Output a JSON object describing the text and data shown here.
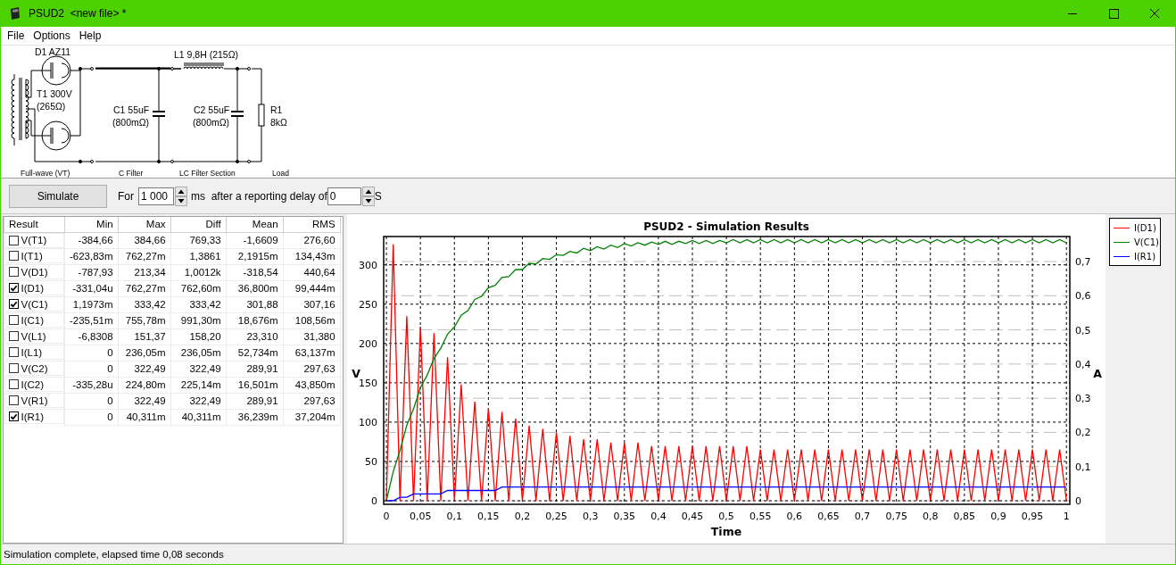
{
  "window": {
    "title": "PSUD2  <new file> *"
  },
  "menu": [
    {
      "label": "File"
    },
    {
      "label": "Options"
    },
    {
      "label": "Help"
    }
  ],
  "schematic": {
    "rectifier": {
      "name": "D1 AZ11",
      "transformer": "T1 300V",
      "resistance": "(265Ω)"
    },
    "inductor": "L1 9,8H (215Ω)",
    "capacitors": [
      {
        "value": "C1 55uF",
        "esr": "(800mΩ)"
      },
      {
        "value": "C2 55uF",
        "esr": "(800mΩ)"
      }
    ],
    "load": {
      "name": "R1",
      "value": "8kΩ"
    },
    "sections": [
      "Full-wave (VT)",
      "C Filter",
      "LC Filter Section",
      "Load"
    ]
  },
  "controls": {
    "simulate": "Simulate",
    "for_label": "For",
    "duration": "1 000",
    "ms_label": "ms  after a reporting delay of",
    "delay": "0",
    "s_label": "S"
  },
  "results": {
    "columns": [
      "Result",
      "Min",
      "Max",
      "Diff",
      "Mean",
      "RMS"
    ],
    "rows": [
      {
        "name": "V(T1)",
        "checked": false,
        "values": [
          "-384,66",
          "384,66",
          "769,33",
          "-1,6609",
          "276,60"
        ]
      },
      {
        "name": "I(T1)",
        "checked": false,
        "values": [
          "-623,83m",
          "762,27m",
          "1,3861",
          "2,1915m",
          "134,43m"
        ]
      },
      {
        "name": "V(D1)",
        "checked": false,
        "values": [
          "-787,93",
          "213,34",
          "1,0012k",
          "-318,54",
          "440,64"
        ]
      },
      {
        "name": "I(D1)",
        "checked": true,
        "values": [
          "-331,04u",
          "762,27m",
          "762,60m",
          "36,800m",
          "99,444m"
        ]
      },
      {
        "name": "V(C1)",
        "checked": true,
        "values": [
          "1,1973m",
          "333,42",
          "333,42",
          "301,88",
          "307,16"
        ]
      },
      {
        "name": "I(C1)",
        "checked": false,
        "values": [
          "-235,51m",
          "755,78m",
          "991,30m",
          "18,676m",
          "108,56m"
        ]
      },
      {
        "name": "V(L1)",
        "checked": false,
        "values": [
          "-6,8308",
          "151,37",
          "158,20",
          "23,310",
          "31,380"
        ]
      },
      {
        "name": "I(L1)",
        "checked": false,
        "values": [
          "0",
          "236,05m",
          "236,05m",
          "52,734m",
          "63,137m"
        ]
      },
      {
        "name": "V(C2)",
        "checked": false,
        "values": [
          "0",
          "322,49",
          "322,49",
          "289,91",
          "297,63"
        ]
      },
      {
        "name": "I(C2)",
        "checked": false,
        "values": [
          "-335,28u",
          "224,80m",
          "225,14m",
          "16,501m",
          "43,850m"
        ]
      },
      {
        "name": "V(R1)",
        "checked": false,
        "values": [
          "0",
          "322,49",
          "322,49",
          "289,91",
          "297,63"
        ]
      },
      {
        "name": "I(R1)",
        "checked": true,
        "values": [
          "0",
          "40,311m",
          "40,311m",
          "36,239m",
          "37,204m"
        ]
      }
    ]
  },
  "chart": {
    "chart_data": {
      "type": "line",
      "title": "PSUD2 - Simulation Results",
      "xlabel": "Time",
      "ylabel": "V",
      "y2label": "A",
      "grid": true,
      "xlim": [
        -0.004,
        1.005
      ],
      "ylim": [
        -4.5,
        336
      ],
      "y2lim": [
        -0.0104,
        0.7731
      ],
      "xticks": [
        0,
        {
          "value": 0.05,
          "label": "0,05"
        },
        {
          "value": 0.1,
          "label": "0,1"
        },
        {
          "value": 0.15,
          "label": "0,15"
        },
        {
          "value": 0.2,
          "label": "0,2"
        },
        {
          "value": 0.25,
          "label": "0,25"
        },
        {
          "value": 0.3,
          "label": "0,3"
        },
        {
          "value": 0.35,
          "label": "0,35"
        },
        {
          "value": 0.4,
          "label": "0,4"
        },
        {
          "value": 0.45,
          "label": "0,45"
        },
        {
          "value": 0.5,
          "label": "0,5"
        },
        {
          "value": 0.55,
          "label": "0,55"
        },
        {
          "value": 0.6,
          "label": "0,6"
        },
        {
          "value": 0.65,
          "label": "0,65"
        },
        {
          "value": 0.7,
          "label": "0,7"
        },
        {
          "value": 0.75,
          "label": "0,75"
        },
        {
          "value": 0.8,
          "label": "0,8"
        },
        {
          "value": 0.85,
          "label": "0,85"
        },
        {
          "value": 0.9,
          "label": "0,9"
        },
        {
          "value": 0.95,
          "label": "0,95"
        },
        1
      ],
      "yticks": [
        0,
        50,
        100,
        150,
        200,
        250,
        300
      ],
      "y2ticks": [
        0,
        {
          "value": 0.1,
          "label": "0,1"
        },
        {
          "value": 0.2,
          "label": "0,2"
        },
        {
          "value": 0.3,
          "label": "0,3"
        },
        {
          "value": 0.4,
          "label": "0,4"
        },
        {
          "value": 0.5,
          "label": "0,5"
        },
        {
          "value": 0.6,
          "label": "0,6"
        },
        {
          "value": 0.7,
          "label": "0,7"
        }
      ],
      "x": [
        0,
        0.01,
        0.02,
        0.03,
        0.04,
        0.05,
        0.06,
        0.07,
        0.08,
        0.09,
        0.1,
        0.11,
        0.12,
        0.13,
        0.14,
        0.15,
        0.16,
        0.17,
        0.18,
        0.19,
        0.2,
        0.21,
        0.22,
        0.23,
        0.24,
        0.25,
        0.26,
        0.27,
        0.28,
        0.29,
        0.3,
        0.31,
        0.32,
        0.33,
        0.34,
        0.35,
        0.36,
        0.37,
        0.38,
        0.39,
        0.4,
        0.41,
        0.42,
        0.43,
        0.44,
        0.45,
        0.46,
        0.47,
        0.48,
        0.49,
        0.5,
        0.51,
        0.52,
        0.53,
        0.54,
        0.55,
        0.56,
        0.57,
        0.58,
        0.59,
        0.6,
        0.61,
        0.62,
        0.63,
        0.64,
        0.65,
        0.66,
        0.67,
        0.68,
        0.69,
        0.7,
        0.71,
        0.72,
        0.73,
        0.74,
        0.75,
        0.76,
        0.77,
        0.78,
        0.79,
        0.8,
        0.81,
        0.82,
        0.83,
        0.84,
        0.85,
        0.86,
        0.87,
        0.88,
        0.89,
        0.9,
        0.91,
        0.92,
        0.93,
        0.94,
        0.95,
        0.96,
        0.97,
        0.98,
        0.99,
        1
      ],
      "series": [
        {
          "name": "I(D1)",
          "color": "#ff0000",
          "axis": "y2",
          "values": [
            0,
            0.75,
            0,
            0.54,
            0,
            0.51,
            0,
            0.49,
            0,
            0.42,
            0,
            0.34,
            0,
            0.29,
            0,
            0.27,
            0,
            0.26,
            0,
            0.24,
            0,
            0.22,
            0,
            0.21,
            0,
            0.2,
            0,
            0.19,
            0,
            0.18,
            0,
            0.18,
            0,
            0.17,
            0,
            0.17,
            0,
            0.17,
            0,
            0.16,
            0,
            0.16,
            0,
            0.16,
            0,
            0.16,
            0,
            0.16,
            0,
            0.16,
            0,
            0.16,
            0,
            0.16,
            0,
            0.15,
            0,
            0.15,
            0,
            0.15,
            0,
            0.15,
            0,
            0.15,
            0,
            0.15,
            0,
            0.15,
            0,
            0.15,
            0,
            0.15,
            0,
            0.15,
            0,
            0.15,
            0,
            0.15,
            0,
            0.15,
            0,
            0.15,
            0,
            0.15,
            0,
            0.15,
            0,
            0.15,
            0,
            0.15,
            0,
            0.15,
            0,
            0.15,
            0,
            0.15,
            0,
            0.15,
            0,
            0.15,
            0
          ]
        },
        {
          "name": "V(C1)",
          "color": "#008000",
          "values": [
            0,
            37,
            64,
            96,
            117,
            144,
            160,
            181,
            194,
            212,
            221,
            236,
            242,
            256,
            260,
            271,
            274,
            284,
            285,
            294,
            294,
            302,
            301,
            308,
            307,
            313,
            312,
            317,
            315,
            321,
            318,
            323,
            320,
            325,
            322,
            327,
            324,
            328,
            325,
            329,
            326,
            330,
            326,
            330,
            327,
            331,
            327,
            331,
            327,
            331,
            328,
            332,
            328,
            332,
            328,
            332,
            328,
            332,
            328,
            332,
            328,
            332,
            328,
            332,
            328,
            332,
            328,
            332,
            328,
            332,
            328,
            332,
            328,
            332,
            328,
            332,
            328,
            332,
            328,
            332,
            328,
            332,
            328,
            332,
            328,
            332,
            328,
            332,
            328,
            332,
            328,
            332,
            328,
            332,
            328,
            332,
            328,
            332,
            328,
            332,
            328
          ]
        },
        {
          "name": "I(R1)",
          "color": "#0000ff",
          "axis": "y2",
          "values": [
            0,
            0,
            0.01,
            0.01,
            0.02,
            0.02,
            0.02,
            0.02,
            0.02,
            0.03,
            0.03,
            0.03,
            0.03,
            0.03,
            0.03,
            0.03,
            0.03,
            0.04,
            0.04,
            0.04,
            0.04,
            0.04,
            0.04,
            0.04,
            0.04,
            0.04,
            0.04,
            0.04,
            0.04,
            0.04,
            0.04,
            0.04,
            0.04,
            0.04,
            0.04,
            0.04,
            0.04,
            0.04,
            0.04,
            0.04,
            0.04,
            0.04,
            0.04,
            0.04,
            0.04,
            0.04,
            0.04,
            0.04,
            0.04,
            0.04,
            0.04,
            0.04,
            0.04,
            0.04,
            0.04,
            0.04,
            0.04,
            0.04,
            0.04,
            0.04,
            0.04,
            0.04,
            0.04,
            0.04,
            0.04,
            0.04,
            0.04,
            0.04,
            0.04,
            0.04,
            0.04,
            0.04,
            0.04,
            0.04,
            0.04,
            0.04,
            0.04,
            0.04,
            0.04,
            0.04,
            0.04,
            0.04,
            0.04,
            0.04,
            0.04,
            0.04,
            0.04,
            0.04,
            0.04,
            0.04,
            0.04,
            0.04,
            0.04,
            0.04,
            0.04,
            0.04,
            0.04,
            0.04,
            0.04,
            0.04,
            0.04
          ]
        }
      ]
    }
  },
  "status_bar": "Simulation complete, elapsed time 0,08 seconds"
}
